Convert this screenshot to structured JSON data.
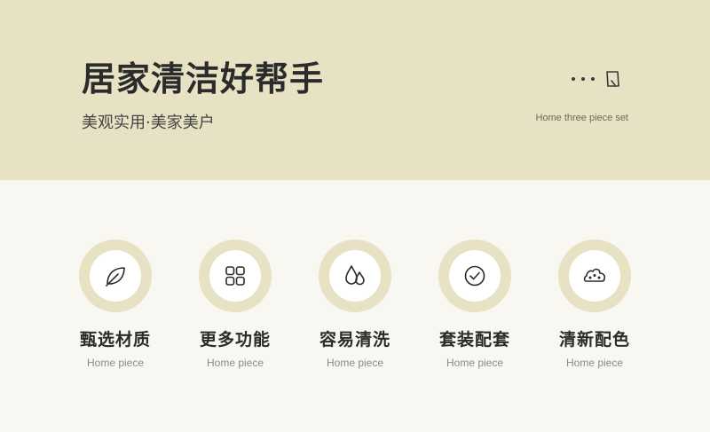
{
  "header": {
    "title": "居家清洁好帮手",
    "subtitle": "美观实用·美家美户",
    "english_tag": "Home three piece set",
    "icons": [
      "more-dots-icon",
      "document-icon"
    ]
  },
  "features": [
    {
      "title": "甄选材质",
      "subtitle": "Home piece",
      "icon": "leaf-icon"
    },
    {
      "title": "更多功能",
      "subtitle": "Home piece",
      "icon": "grid-icon"
    },
    {
      "title": "容易清洗",
      "subtitle": "Home piece",
      "icon": "water-drops-icon"
    },
    {
      "title": "套装配套",
      "subtitle": "Home piece",
      "icon": "check-circle-icon"
    },
    {
      "title": "清新配色",
      "subtitle": "Home piece",
      "icon": "palette-icon"
    }
  ],
  "colors": {
    "band": "#e7e2c4",
    "background": "#f9f7f2",
    "text": "#2b2b2b",
    "muted": "#8a8a8a"
  }
}
